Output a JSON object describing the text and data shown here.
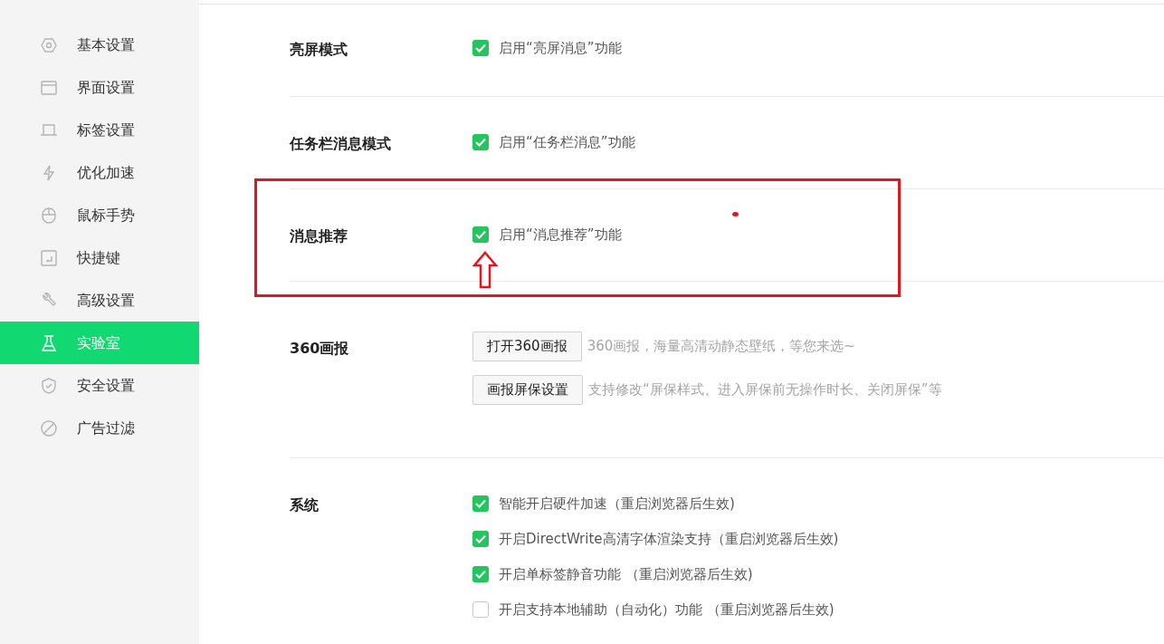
{
  "sidebar": {
    "items": [
      {
        "label": "基本设置",
        "kind": "hexagon",
        "selected": false
      },
      {
        "label": "界面设置",
        "kind": "window",
        "selected": false
      },
      {
        "label": "标签设置",
        "kind": "tab",
        "selected": false
      },
      {
        "label": "优化加速",
        "kind": "bolt",
        "selected": false
      },
      {
        "label": "鼠标手势",
        "kind": "mouse",
        "selected": false
      },
      {
        "label": "快捷键",
        "kind": "key",
        "selected": false
      },
      {
        "label": "高级设置",
        "kind": "wrench",
        "selected": false
      },
      {
        "label": "实验室",
        "kind": "flask",
        "selected": true
      },
      {
        "label": "安全设置",
        "kind": "shield",
        "selected": false
      },
      {
        "label": "广告过滤",
        "kind": "block",
        "selected": false
      }
    ]
  },
  "sections": [
    {
      "label": "亮屏模式",
      "kind": "checkbox",
      "options": [
        {
          "text": "启用“亮屏消息”功能",
          "checked": true
        }
      ]
    },
    {
      "label": "任务栏消息模式",
      "kind": "checkbox",
      "options": [
        {
          "text": "启用“任务栏消息”功能",
          "checked": true
        }
      ]
    },
    {
      "label": "消息推荐",
      "kind": "checkbox",
      "options": [
        {
          "text": "启用“消息推荐”功能",
          "checked": true
        }
      ]
    },
    {
      "label": "360画报",
      "kind": "buttons",
      "actions": [
        {
          "button": "打开360画报",
          "hint": "360画报，海量高清动静态壁纸，等您来选~"
        },
        {
          "button": "画报屏保设置",
          "hint": "支持修改“屏保样式、进入屏保前无操作时长、关闭屏保”等"
        }
      ]
    },
    {
      "label": "系统",
      "kind": "checkbox",
      "options": [
        {
          "text": "智能开启硬件加速（重启浏览器后生效)",
          "checked": true
        },
        {
          "text": "开启DirectWrite高清字体渲染支持（重启浏览器后生效)",
          "checked": true
        },
        {
          "text": "开启单标签静音功能 （重启浏览器后生效)",
          "checked": true
        },
        {
          "text": "开启支持本地辅助（自动化）功能 （重启浏览器后生效)",
          "checked": false
        }
      ]
    }
  ],
  "annotations": [
    {
      "kind": "frame"
    },
    {
      "kind": "arrow"
    },
    {
      "kind": "dot"
    }
  ]
}
